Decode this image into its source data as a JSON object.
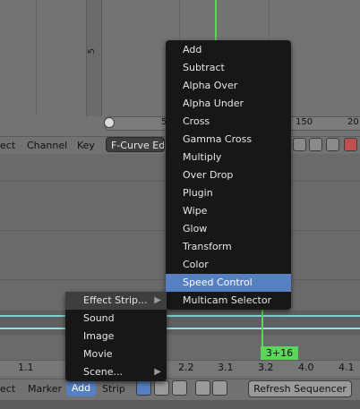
{
  "graph": {
    "vscroll_label": "5",
    "hscroll_ticks": [
      "5",
      "150",
      "20"
    ]
  },
  "header_top": {
    "items": [
      "ect",
      "Channel",
      "Key"
    ],
    "mode_select": "F-Curve Edit"
  },
  "sequencer": {
    "frame_badge": "3+16",
    "ruler_ticks": [
      "1.1",
      "2.2",
      "3.1",
      "3.2",
      "4.0",
      "4.1"
    ]
  },
  "footer": {
    "items": [
      "ect",
      "Marker",
      "Add",
      "Strip"
    ],
    "active_menu": "Add",
    "refresh_label": "Refresh Sequencer"
  },
  "add_menu": {
    "items": [
      {
        "label": "Effect Strip...",
        "has_submenu": true
      },
      {
        "label": "Sound"
      },
      {
        "label": "Image"
      },
      {
        "label": "Movie"
      },
      {
        "label": "Scene...",
        "has_submenu": true
      }
    ],
    "submenu_arrow": "▶"
  },
  "effect_submenu": {
    "items": [
      "Add",
      "Subtract",
      "Alpha Over",
      "Alpha Under",
      "Cross",
      "Gamma Cross",
      "Multiply",
      "Over Drop",
      "Plugin",
      "Wipe",
      "Glow",
      "Transform",
      "Color",
      "Speed Control",
      "Multicam Selector"
    ],
    "highlighted": "Speed Control"
  },
  "colors": {
    "menu_bg": "#171717",
    "highlight": "#5680c2",
    "frame_cursor": "#5bd65b",
    "strip_line": "#8ee0e0"
  }
}
